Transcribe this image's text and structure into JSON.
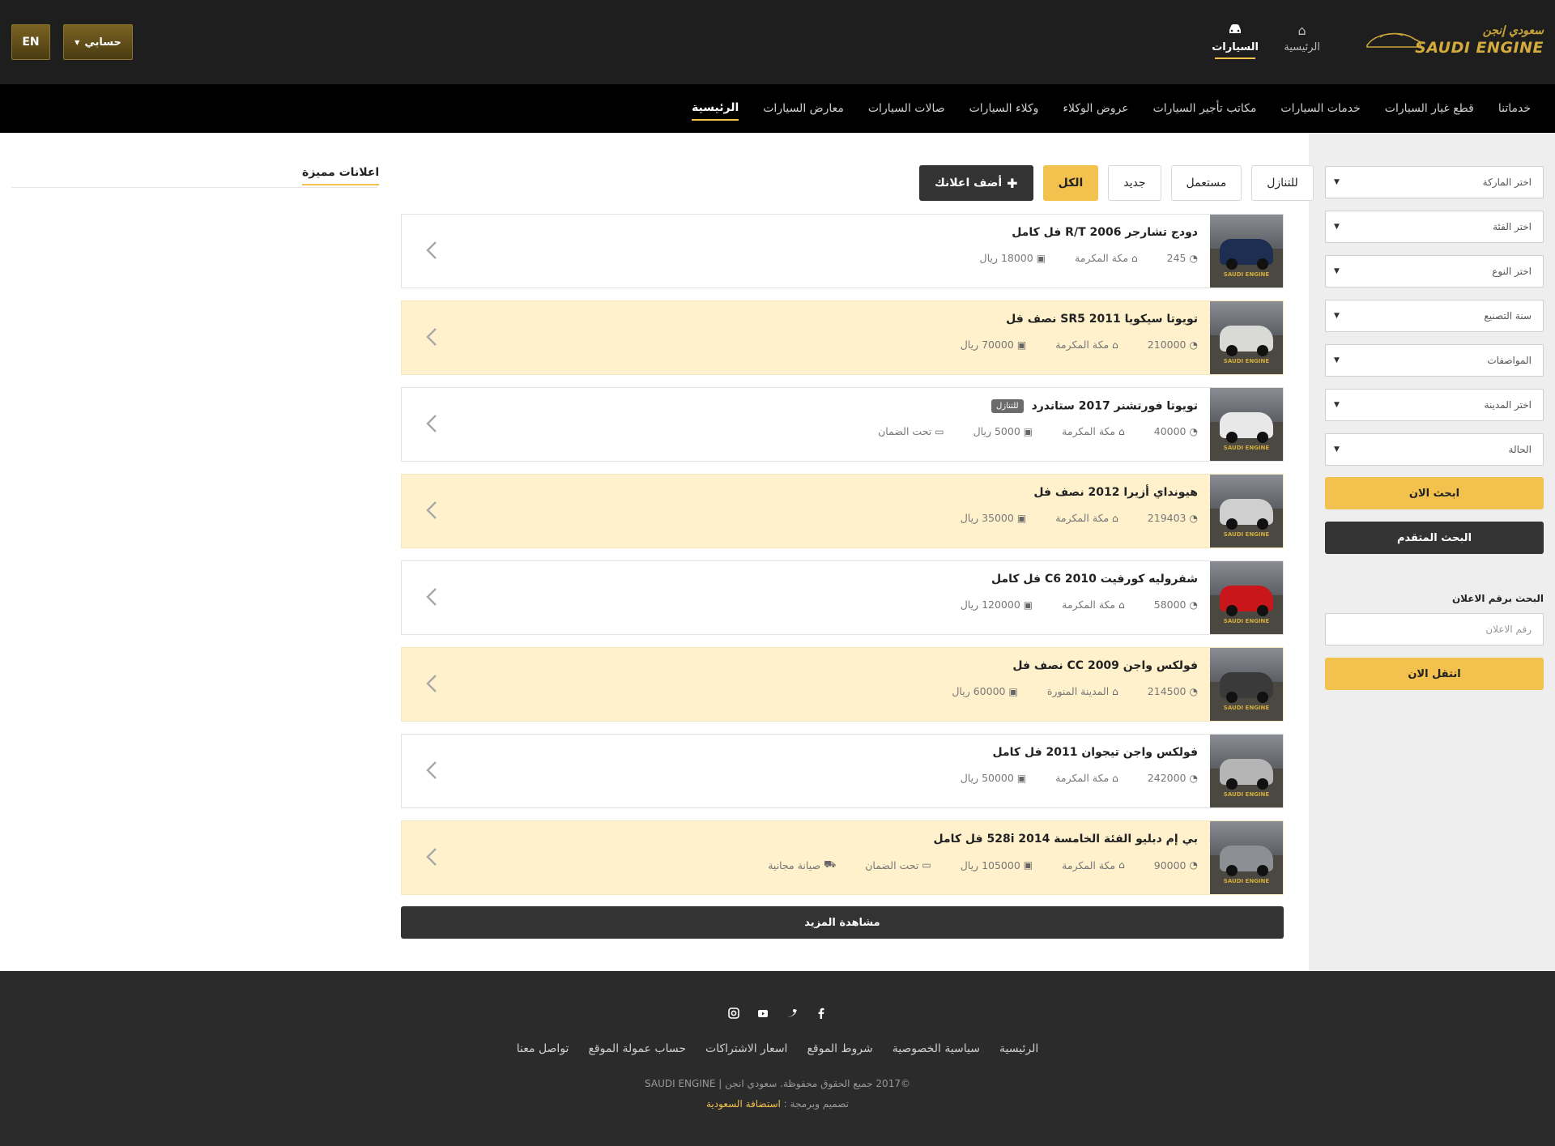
{
  "header": {
    "logo_ar": "سعودي إنجن",
    "logo_en": "SAUDI ENGINE",
    "nav": [
      {
        "label": "الرئيسية",
        "icon": "home-icon"
      },
      {
        "label": "السيارات",
        "icon": "car-icon",
        "active": true
      }
    ],
    "account_label": "حسابي",
    "lang_label": "EN"
  },
  "mainnav": {
    "items": [
      "الرئيسية",
      "معارض السيارات",
      "صالات السيارات",
      "وكلاء السيارات",
      "عروض الوكلاء",
      "مكاتب تأجير السيارات",
      "خدمات السيارات",
      "قطع غيار السيارات",
      "خدماتنا"
    ],
    "active": 0
  },
  "sidebar": {
    "selects": [
      "اختر الماركة",
      "اختر الفئة",
      "اختر النوع",
      "سنة التصنيع",
      "المواصفات",
      "اختر المدينة",
      "الحالة"
    ],
    "search_now": "ابحث الان",
    "advanced_search": "البحث المتقدم",
    "adno_label": "البحث برقم الاعلان",
    "adno_placeholder": "رقم الاعلان",
    "go_now": "انتقل الان"
  },
  "filters": {
    "add_ad": "أضف اعلانك",
    "all": "الكل",
    "new": "جديد",
    "used": "مستعمل",
    "transfer": "للتنازل"
  },
  "listings": [
    {
      "title": "دودج تشارجر R/T 2006 فل كامل",
      "mileage": "245",
      "city": "مكة المكرمة",
      "price": "18000 ريال",
      "alt": false,
      "color": "#1e2d52"
    },
    {
      "title": "تويوتا سيكويا SR5 2011 نصف فل",
      "mileage": "210000",
      "city": "مكة المكرمة",
      "price": "70000 ريال",
      "alt": true,
      "color": "#d9d9d6"
    },
    {
      "title": "تويوتا فورتشنر 2017 ستاندرد",
      "badge": "للتنازل",
      "mileage": "40000",
      "city": "مكة المكرمة",
      "price": "5000 ريال",
      "warranty": "تحت الضمان",
      "alt": false,
      "color": "#e8e8e8"
    },
    {
      "title": "هيونداي أزيرا 2012 نصف فل",
      "mileage": "219403",
      "city": "مكة المكرمة",
      "price": "35000 ريال",
      "alt": true,
      "color": "#cfcfcf"
    },
    {
      "title": "شفروليه كورفيت C6 2010 فل كامل",
      "mileage": "58000",
      "city": "مكة المكرمة",
      "price": "120000 ريال",
      "alt": false,
      "color": "#c8161b"
    },
    {
      "title": "فولكس واجن CC 2009 نصف فل",
      "mileage": "214500",
      "city": "المدينة المنورة",
      "price": "60000 ريال",
      "alt": true,
      "color": "#3a3a3a"
    },
    {
      "title": "فولكس واجن تيجوان 2011 فل كامل",
      "mileage": "242000",
      "city": "مكة المكرمة",
      "price": "50000 ريال",
      "alt": false,
      "color": "#b5b5b5"
    },
    {
      "title": "بي إم دبليو الفئة الخامسة 528i 2014 فل كامل",
      "mileage": "90000",
      "city": "مكة المكرمة",
      "price": "105000 ريال",
      "warranty": "تحت الضمان",
      "maintenance": "صيانة مجانية",
      "alt": true,
      "color": "#8c8f94"
    }
  ],
  "watermark": "SAUDI ENGINE",
  "more_label": "مشاهدة المزيد",
  "featured_title": "اعلانات مميزة",
  "footer": {
    "social": [
      "facebook-icon",
      "twitter-icon",
      "youtube-icon",
      "instagram-icon"
    ],
    "links": [
      "الرئيسية",
      "سياسية الخصوصية",
      "شروط الموقع",
      "اسعار الاشتراكات",
      "حساب عمولة الموقع",
      "تواصل معنا"
    ],
    "copyright": "©2017 جميع الحقوق محفوظة. سعودي انجن | SAUDI ENGINE",
    "credit_prefix": "تصميم وبرمجة :",
    "credit_name": "استضافة السعودية"
  },
  "colors": {
    "accent": "#f2c14e",
    "dark": "#333333",
    "header_bg": "#1e1e1e",
    "alt_row": "#fff1cc"
  }
}
